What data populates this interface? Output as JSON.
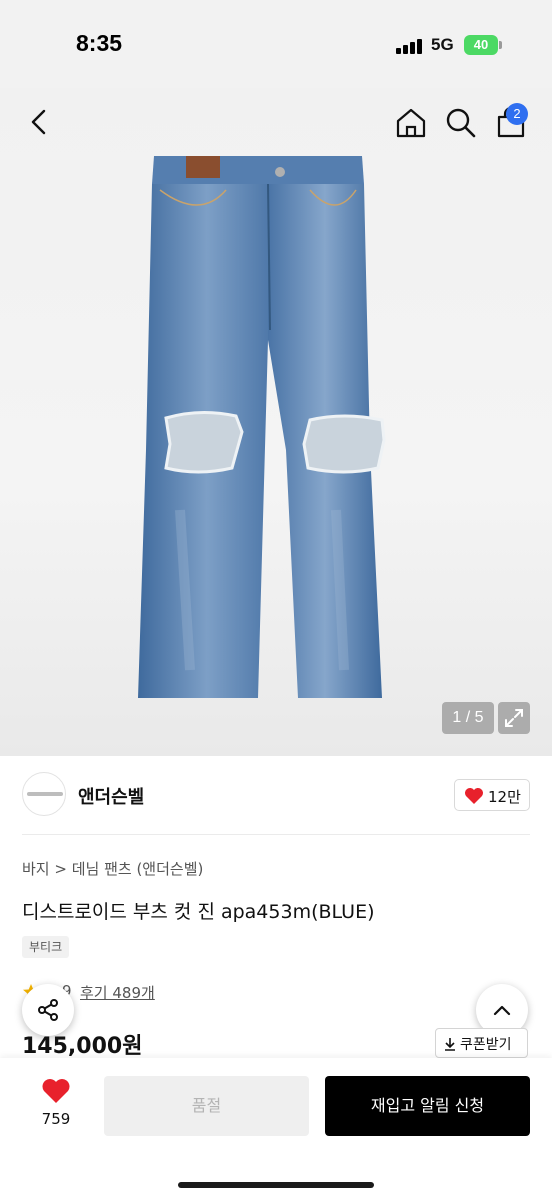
{
  "status_bar": {
    "time": "8:35",
    "network": "5G",
    "battery": "40"
  },
  "header": {
    "cart_count": "2"
  },
  "gallery": {
    "pager": "1 / 5"
  },
  "brand": {
    "name": "앤더슨벨",
    "likes": "12만"
  },
  "product": {
    "breadcrumb": "바지 > 데님 팬츠 (앤더슨벨)",
    "title": "디스트로이드 부츠 컷 진 apa453m(BLUE)",
    "tag": "부티크",
    "rating": "9",
    "reviews": "후기 489개",
    "price": "145,000원",
    "coupon_label": "쿠폰받기"
  },
  "actions": {
    "wish_count": "759",
    "soldout_label": "품절",
    "restock_label": "재입고 알림 신청"
  },
  "colors": {
    "accent": "#2f6ff0",
    "heart": "#e8212c",
    "primary_button": "#000000",
    "denim": "#4e77a8"
  }
}
